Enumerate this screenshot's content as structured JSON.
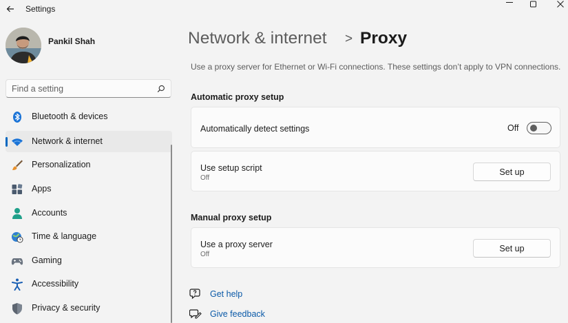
{
  "window": {
    "title": "Settings",
    "icons": {
      "back": "arrow-left-icon",
      "minimize": "minimize-icon",
      "maximize": "maximize-icon",
      "close": "close-icon"
    }
  },
  "profile": {
    "name": "Pankil Shah"
  },
  "search": {
    "placeholder": "Find a setting",
    "icon": "search-icon"
  },
  "sidebar": {
    "items": [
      {
        "label": "Bluetooth & devices",
        "icon": "bluetooth-icon"
      },
      {
        "label": "Network & internet",
        "icon": "wifi-icon",
        "selected": true
      },
      {
        "label": "Personalization",
        "icon": "paintbrush-icon"
      },
      {
        "label": "Apps",
        "icon": "apps-icon"
      },
      {
        "label": "Accounts",
        "icon": "accounts-icon"
      },
      {
        "label": "Time & language",
        "icon": "globe-clock-icon"
      },
      {
        "label": "Gaming",
        "icon": "gamepad-icon"
      },
      {
        "label": "Accessibility",
        "icon": "accessibility-icon"
      },
      {
        "label": "Privacy & security",
        "icon": "shield-icon"
      }
    ]
  },
  "breadcrumb": {
    "parent": "Network & internet",
    "separator": ">",
    "current": "Proxy"
  },
  "description": "Use a proxy server for Ethernet or Wi-Fi connections. These settings don’t apply to VPN connections.",
  "automatic": {
    "title": "Automatic proxy setup",
    "detect": {
      "label": "Automatically detect settings",
      "state": "Off",
      "on": false
    },
    "script": {
      "label": "Use setup script",
      "status": "Off",
      "button": "Set up"
    }
  },
  "manual": {
    "title": "Manual proxy setup",
    "proxy": {
      "label": "Use a proxy server",
      "status": "Off",
      "button": "Set up"
    }
  },
  "links": {
    "help": {
      "label": "Get help",
      "icon": "help-icon"
    },
    "feedback": {
      "label": "Give feedback",
      "icon": "feedback-icon"
    }
  },
  "colors": {
    "accent": "#0067c0",
    "link": "#0b5aa8",
    "background": "#f3f3f3",
    "card": "#fbfbfb"
  }
}
